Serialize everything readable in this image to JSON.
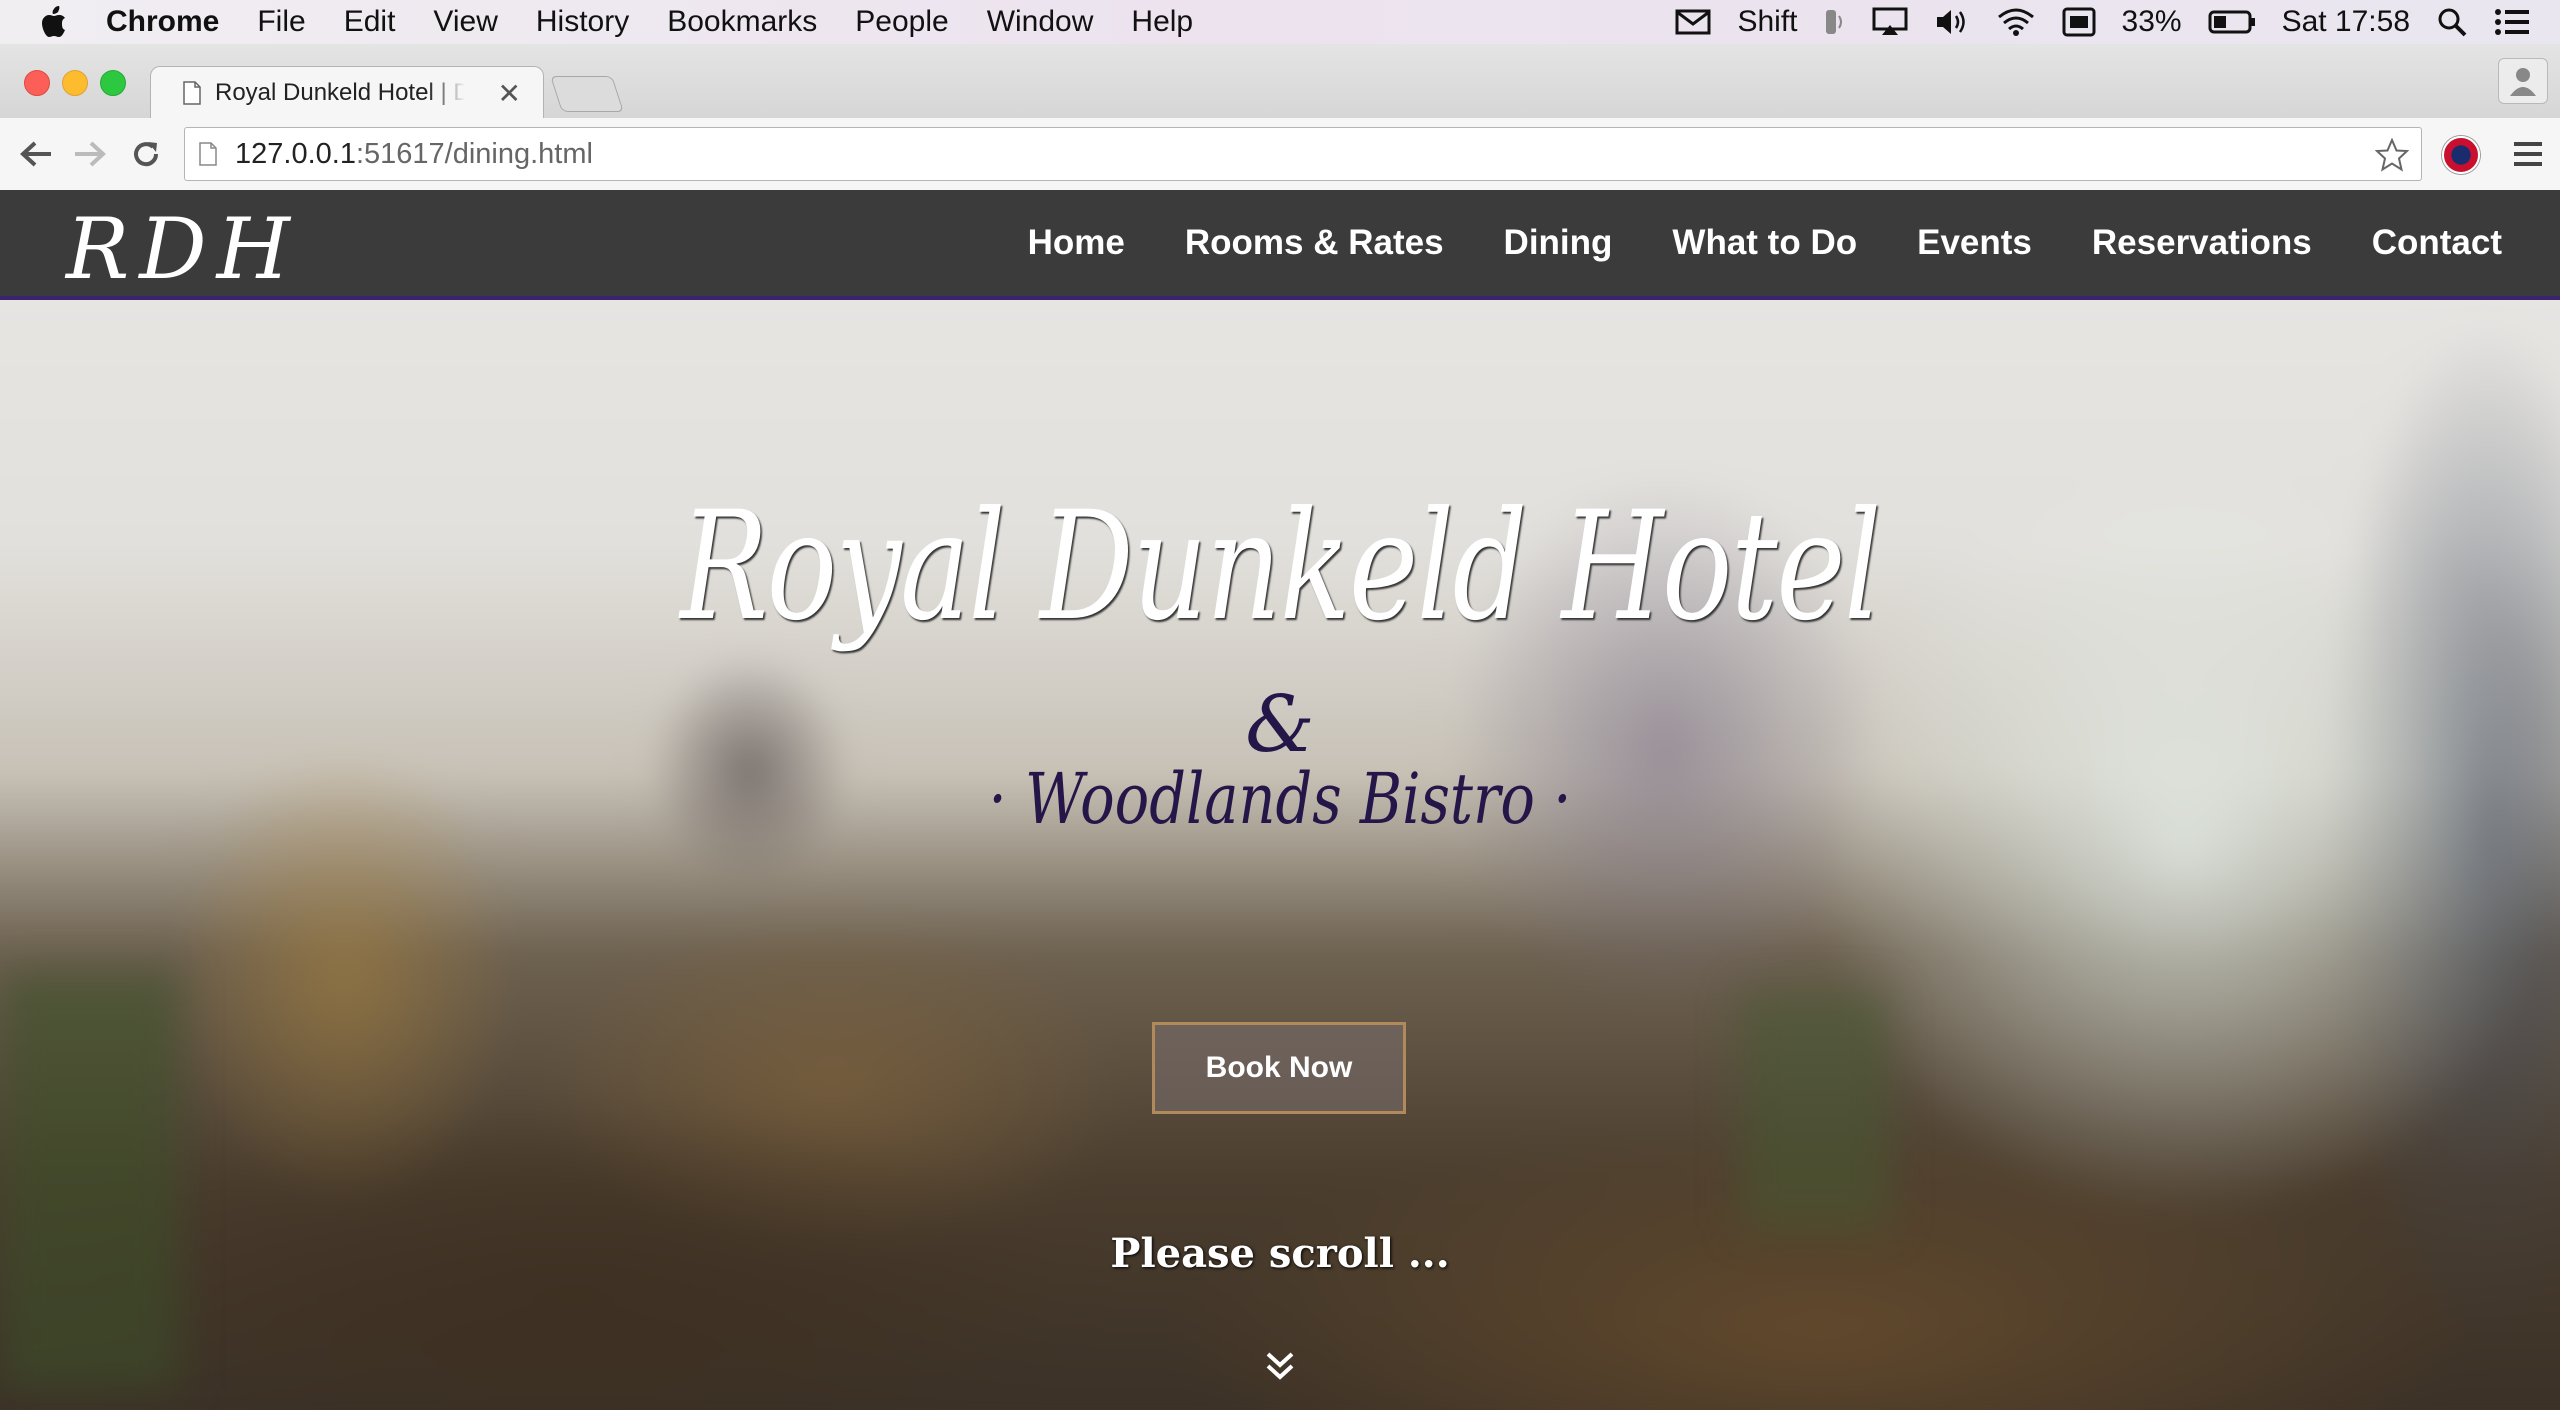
{
  "menubar": {
    "app": "Chrome",
    "items": [
      "File",
      "Edit",
      "View",
      "History",
      "Bookmarks",
      "People",
      "Window",
      "Help"
    ],
    "status": {
      "shift_label": "Shift",
      "battery": "33%",
      "clock": "Sat 17:58"
    }
  },
  "browser": {
    "tab_title": "Royal Dunkeld Hotel | Dining",
    "url_host": "127.0.0.1",
    "url_rest": ":51617/dining.html"
  },
  "site": {
    "logo": "RDH",
    "nav": [
      "Home",
      "Rooms & Rates",
      "Dining",
      "What to Do",
      "Events",
      "Reservations",
      "Contact"
    ],
    "hero": {
      "title": "Royal Dunkeld Hotel",
      "ampersand": "&",
      "subtitle": "· Woodlands Bistro ·",
      "book_button": "Book Now",
      "scroll_text": "Please scroll ..."
    },
    "colors": {
      "nav_bg": "#3b3b3b",
      "nav_border": "#3a2470",
      "subtitle": "#241648",
      "button_border": "#b08a5a"
    }
  }
}
